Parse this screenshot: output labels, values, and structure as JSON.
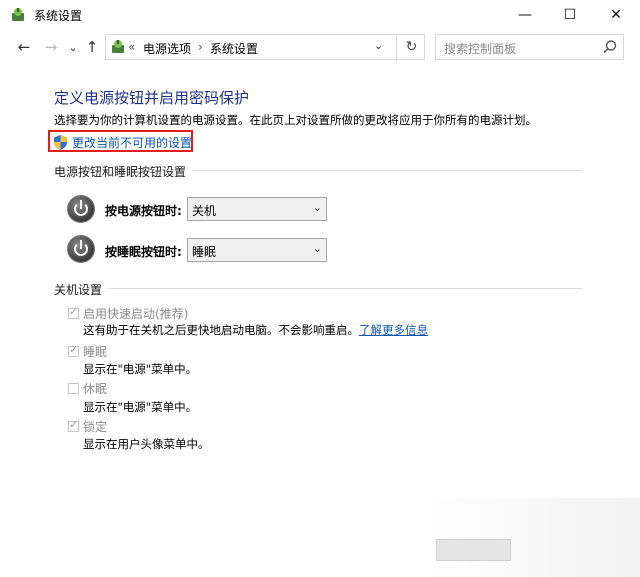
{
  "window": {
    "title": "系统设置",
    "controls": {
      "minimize": "—",
      "maximize": "☐",
      "close": "✕"
    }
  },
  "nav": {
    "back": "←",
    "forward": "→",
    "history": "⌄",
    "up": "↑"
  },
  "address": {
    "overflow": "«",
    "crumb1": "电源选项",
    "separator": "›",
    "crumb2": "系统设置",
    "dropdown": "⌄",
    "refresh": "↻"
  },
  "search": {
    "placeholder": "搜索控制面板"
  },
  "page": {
    "heading": "定义电源按钮并启用密码保护",
    "description": "选择要为你的计算机设置的电源设置。在此页上对设置所做的更改将应用于你所有的电源计划。",
    "change_link": "更改当前不可用的设置"
  },
  "buttons_section": {
    "title": "电源按钮和睡眠按钮设置",
    "power_button": {
      "label": "按电源按钮时:",
      "value": "关机"
    },
    "sleep_button": {
      "label": "按睡眠按钮时:",
      "value": "睡眠"
    }
  },
  "shutdown_section": {
    "title": "关机设置",
    "items": [
      {
        "label": "启用快速启动(推荐)",
        "checked": true,
        "desc": "这有助于在关机之后更快地启动电脑。不会影响重启。",
        "link": "了解更多信息"
      },
      {
        "label": "睡眠",
        "checked": true,
        "desc": "显示在\"电源\"菜单中。"
      },
      {
        "label": "休眠",
        "checked": false,
        "desc": "显示在\"电源\"菜单中。"
      },
      {
        "label": "锁定",
        "checked": true,
        "desc": "显示在用户头像菜单中。"
      }
    ]
  },
  "colors": {
    "heading": "#1e3287",
    "link": "#0a54b0",
    "highlight_border": "#e0201f"
  }
}
